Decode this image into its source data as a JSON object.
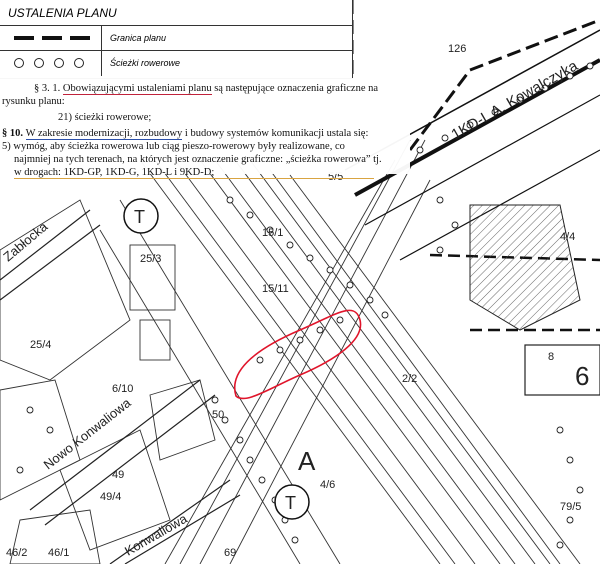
{
  "legend": {
    "title": "USTALENIA PLANU",
    "rows": [
      {
        "label": "Granica planu",
        "symbol": "dashed-line"
      },
      {
        "label": "Ścieżki rowerowe",
        "symbol": "circles-row"
      }
    ]
  },
  "text": {
    "l1a": "§ 3. 1. ",
    "l1b": "Obowiązującymi ustaleniami planu",
    "l1c": " są następujące oznaczenia graficzne na",
    "l2": "rysunku planu:",
    "l3": "21) ścieżki rowerowe;",
    "l4a": "§ 10. ",
    "l4b": "W zakresie modernizacji, rozbudowy",
    "l4c": " i budowy systemów komunikacji ustala się:",
    "l5": "5) wymóg, aby ścieżka rowerowa lub ciąg pieszo-rowerowy były realizowane, co",
    "l6": "najmniej na tych terenach, na których jest oznaczenie graficzne: „ścieżka rowerowa” tj.",
    "l7": "w drogach: 1KD-GP, 1KD-G, 1KD-L i 9KD-D;"
  },
  "map_labels": {
    "street_kowalczyka": "1KD-L A. Kowalczyka",
    "street_zablocka": "Zabłocka",
    "street_nowo": "Nowo Konwaliowa",
    "street_konwaliowa": "Konwaliowa",
    "letter_t1": "T",
    "letter_t2": "T",
    "letter_a": "A",
    "parcels": [
      "126",
      "25/3",
      "25/4",
      "15/1",
      "15/11",
      "5/5",
      "50",
      "49",
      "49/4",
      "46/1",
      "46/2",
      "6/10",
      "4/4",
      "2/2",
      "8",
      "6",
      "69",
      "79/5",
      "4/6"
    ]
  },
  "colors": {
    "highlight_ellipse": "#e0152b",
    "underline_red": "#c0223b",
    "underline_blue": "#2b4fa8",
    "underline_gold": "#d9a441"
  }
}
